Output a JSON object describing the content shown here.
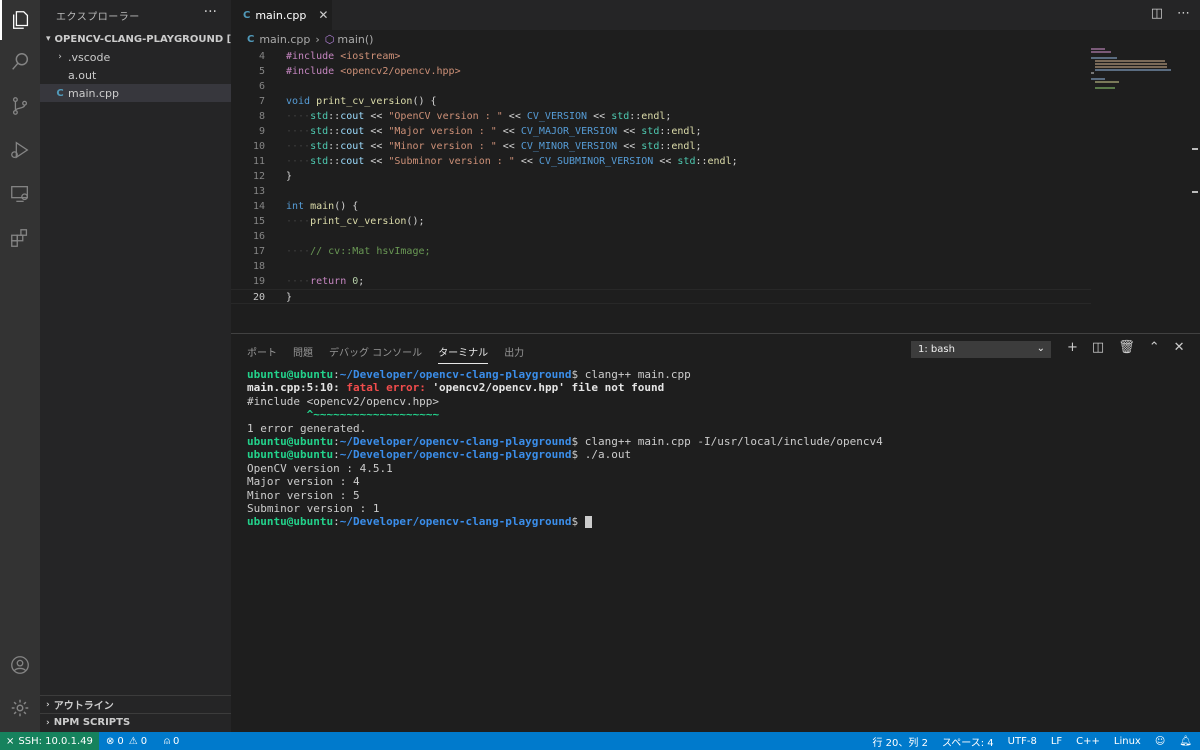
{
  "activity_bar": {
    "items": [
      "explorer-icon",
      "search-icon",
      "source-control-icon",
      "run-debug-icon",
      "remote-explorer-icon",
      "extensions-icon"
    ],
    "bottom": [
      "account-icon",
      "gear-icon"
    ]
  },
  "sidebar": {
    "title": "エクスプローラー",
    "more": "···",
    "folder": "OPENCV-CLANG-PLAYGROUND [S...",
    "items": [
      {
        "label": ".vscode",
        "type": "folder"
      },
      {
        "label": "a.out",
        "type": "file"
      },
      {
        "label": "main.cpp",
        "type": "cpp"
      }
    ],
    "sections": [
      "アウトライン",
      "NPM SCRIPTS"
    ]
  },
  "editor": {
    "tab_label": "main.cpp",
    "tab_icon": "C",
    "breadcrumb": {
      "file": "main.cpp",
      "symbol": "main()"
    },
    "lines": [
      {
        "n": "4",
        "tokens": [
          {
            "c": "kw",
            "t": "#include "
          },
          {
            "c": "str",
            "t": "<iostream>"
          }
        ]
      },
      {
        "n": "5",
        "tokens": [
          {
            "c": "kw",
            "t": "#include "
          },
          {
            "c": "str",
            "t": "<opencv2/opencv.hpp>"
          }
        ]
      },
      {
        "n": "6",
        "tokens": []
      },
      {
        "n": "7",
        "tokens": [
          {
            "c": "blue",
            "t": "void"
          },
          {
            "c": "pl",
            "t": " "
          },
          {
            "c": "fn",
            "t": "print_cv_version"
          },
          {
            "c": "pl",
            "t": "() {"
          }
        ]
      },
      {
        "n": "8",
        "tokens": [
          {
            "c": "ws",
            "t": "····"
          },
          {
            "c": "ns",
            "t": "std"
          },
          {
            "c": "pl",
            "t": "::"
          },
          {
            "c": "var",
            "t": "cout"
          },
          {
            "c": "pl",
            "t": " << "
          },
          {
            "c": "str",
            "t": "\"OpenCV version : \""
          },
          {
            "c": "pl",
            "t": " << "
          },
          {
            "c": "macro",
            "t": "CV_VERSION"
          },
          {
            "c": "pl",
            "t": " << "
          },
          {
            "c": "ns",
            "t": "std"
          },
          {
            "c": "pl",
            "t": "::"
          },
          {
            "c": "fn",
            "t": "endl"
          },
          {
            "c": "pl",
            "t": ";"
          }
        ]
      },
      {
        "n": "9",
        "tokens": [
          {
            "c": "ws",
            "t": "····"
          },
          {
            "c": "ns",
            "t": "std"
          },
          {
            "c": "pl",
            "t": "::"
          },
          {
            "c": "var",
            "t": "cout"
          },
          {
            "c": "pl",
            "t": " << "
          },
          {
            "c": "str",
            "t": "\"Major version : \""
          },
          {
            "c": "pl",
            "t": " << "
          },
          {
            "c": "macro",
            "t": "CV_MAJOR_VERSION"
          },
          {
            "c": "pl",
            "t": " << "
          },
          {
            "c": "ns",
            "t": "std"
          },
          {
            "c": "pl",
            "t": "::"
          },
          {
            "c": "fn",
            "t": "endl"
          },
          {
            "c": "pl",
            "t": ";"
          }
        ]
      },
      {
        "n": "10",
        "tokens": [
          {
            "c": "ws",
            "t": "····"
          },
          {
            "c": "ns",
            "t": "std"
          },
          {
            "c": "pl",
            "t": "::"
          },
          {
            "c": "var",
            "t": "cout"
          },
          {
            "c": "pl",
            "t": " << "
          },
          {
            "c": "str",
            "t": "\"Minor version : \""
          },
          {
            "c": "pl",
            "t": " << "
          },
          {
            "c": "macro",
            "t": "CV_MINOR_VERSION"
          },
          {
            "c": "pl",
            "t": " << "
          },
          {
            "c": "ns",
            "t": "std"
          },
          {
            "c": "pl",
            "t": "::"
          },
          {
            "c": "fn",
            "t": "endl"
          },
          {
            "c": "pl",
            "t": ";"
          }
        ]
      },
      {
        "n": "11",
        "tokens": [
          {
            "c": "ws",
            "t": "····"
          },
          {
            "c": "ns",
            "t": "std"
          },
          {
            "c": "pl",
            "t": "::"
          },
          {
            "c": "var",
            "t": "cout"
          },
          {
            "c": "pl",
            "t": " << "
          },
          {
            "c": "str",
            "t": "\"Subminor version : \""
          },
          {
            "c": "pl",
            "t": " << "
          },
          {
            "c": "macro",
            "t": "CV_SUBMINOR_VERSION"
          },
          {
            "c": "pl",
            "t": " << "
          },
          {
            "c": "ns",
            "t": "std"
          },
          {
            "c": "pl",
            "t": "::"
          },
          {
            "c": "fn",
            "t": "endl"
          },
          {
            "c": "pl",
            "t": ";"
          }
        ]
      },
      {
        "n": "12",
        "tokens": [
          {
            "c": "pl",
            "t": "}"
          }
        ]
      },
      {
        "n": "13",
        "tokens": []
      },
      {
        "n": "14",
        "tokens": [
          {
            "c": "blue",
            "t": "int"
          },
          {
            "c": "pl",
            "t": " "
          },
          {
            "c": "fn",
            "t": "main"
          },
          {
            "c": "pl",
            "t": "() {"
          }
        ]
      },
      {
        "n": "15",
        "tokens": [
          {
            "c": "ws",
            "t": "····"
          },
          {
            "c": "fn",
            "t": "print_cv_version"
          },
          {
            "c": "pl",
            "t": "();"
          }
        ]
      },
      {
        "n": "16",
        "tokens": []
      },
      {
        "n": "17",
        "tokens": [
          {
            "c": "ws",
            "t": "····"
          },
          {
            "c": "cmt",
            "t": "// cv::Mat hsvImage;"
          }
        ]
      },
      {
        "n": "18",
        "tokens": []
      },
      {
        "n": "19",
        "tokens": [
          {
            "c": "ws",
            "t": "····"
          },
          {
            "c": "kw",
            "t": "return"
          },
          {
            "c": "pl",
            "t": " "
          },
          {
            "c": "num",
            "t": "0"
          },
          {
            "c": "pl",
            "t": ";"
          }
        ]
      },
      {
        "n": "20",
        "tokens": [
          {
            "c": "pl",
            "t": "}"
          }
        ],
        "current": true
      }
    ]
  },
  "panel": {
    "tabs": [
      "ポート",
      "問題",
      "デバッグ コンソール",
      "ターミナル",
      "出力"
    ],
    "active_tab": "ターミナル",
    "terminal_select": "1: bash",
    "terminal": [
      [
        {
          "c": "t-user",
          "t": "ubuntu@ubuntu"
        },
        {
          "c": "",
          "t": ":"
        },
        {
          "c": "t-path",
          "t": "~/Developer/opencv-clang-playground"
        },
        {
          "c": "",
          "t": "$ clang++ main.cpp"
        }
      ],
      [
        {
          "c": "t-bold",
          "t": "main.cpp:5:10: "
        },
        {
          "c": "t-err",
          "t": "fatal error: "
        },
        {
          "c": "t-bold",
          "t": "'opencv2/opencv.hpp' file not found"
        }
      ],
      [
        {
          "c": "",
          "t": "#include <opencv2/opencv.hpp>"
        }
      ],
      [
        {
          "c": "",
          "t": "         "
        },
        {
          "c": "t-tilde",
          "t": "^~~~~~~~~~~~~~~~~~~~"
        }
      ],
      [
        {
          "c": "",
          "t": "1 error generated."
        }
      ],
      [
        {
          "c": "t-user",
          "t": "ubuntu@ubuntu"
        },
        {
          "c": "",
          "t": ":"
        },
        {
          "c": "t-path",
          "t": "~/Developer/opencv-clang-playground"
        },
        {
          "c": "",
          "t": "$ clang++ main.cpp -I/usr/local/include/opencv4"
        }
      ],
      [
        {
          "c": "t-user",
          "t": "ubuntu@ubuntu"
        },
        {
          "c": "",
          "t": ":"
        },
        {
          "c": "t-path",
          "t": "~/Developer/opencv-clang-playground"
        },
        {
          "c": "",
          "t": "$ ./a.out"
        }
      ],
      [
        {
          "c": "",
          "t": "OpenCV version : 4.5.1"
        }
      ],
      [
        {
          "c": "",
          "t": "Major version : 4"
        }
      ],
      [
        {
          "c": "",
          "t": "Minor version : 5"
        }
      ],
      [
        {
          "c": "",
          "t": "Subminor version : 1"
        }
      ],
      [
        {
          "c": "t-user",
          "t": "ubuntu@ubuntu"
        },
        {
          "c": "",
          "t": ":"
        },
        {
          "c": "t-path",
          "t": "~/Developer/opencv-clang-playground"
        },
        {
          "c": "",
          "t": "$ "
        },
        {
          "c": "t-cursor",
          "t": ""
        }
      ]
    ]
  },
  "statusbar": {
    "remote": "SSH: 10.0.1.49",
    "errors": "0",
    "warnings": "0",
    "ports": "0",
    "position": "行 20、列 2",
    "spaces": "スペース: 4",
    "encoding": "UTF-8",
    "eol": "LF",
    "language": "C++",
    "os": "Linux"
  },
  "colors": {
    "statusbar": "#007acc",
    "remote": "#16825d",
    "activity_bar": "#333333",
    "sidebar": "#252526",
    "editor": "#1e1e1e"
  }
}
